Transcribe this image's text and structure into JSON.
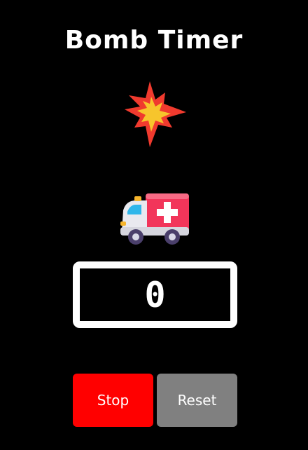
{
  "app": {
    "title": "Bomb Timer"
  },
  "icons": {
    "top": "explosion-icon",
    "middle": "ambulance-icon"
  },
  "timer": {
    "value": "0"
  },
  "buttons": {
    "stop_label": "Stop",
    "reset_label": "Reset"
  },
  "colors": {
    "background": "#000000",
    "text": "#ffffff",
    "stop": "#ff0000",
    "reset": "#808080",
    "display_border": "#ffffff"
  }
}
